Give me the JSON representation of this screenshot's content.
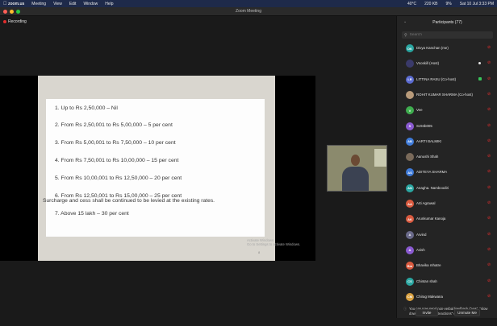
{
  "menubar": {
    "items": [
      "zoom.us",
      "Meeting",
      "View",
      "Edit",
      "Window",
      "Help"
    ],
    "status": [
      "40°C",
      "220 KB",
      "9%",
      "Sat 10 Jul 3:33 PM"
    ]
  },
  "window": {
    "title": "Zoom Meeting"
  },
  "recording": {
    "label": "Recording"
  },
  "slide": {
    "slabs": [
      "1. Up to Rs 2,50,000 – Nil",
      "2. From Rs 2,50,001 to Rs 5,00,000 – 5 per cent",
      "3. From Rs 5,00,001 to Rs 7,50,000 – 10 per cent",
      "4. From Rs 7,50,001 to Rs 10,00,000 – 15 per cent",
      "5. From Rs 10,00,001 to Rs 12,50,000 – 20 per cent",
      "6. From Rs 12,50,001 to Rs 15,00,000 – 25 per cent",
      "7. Above 15 lakh – 30 per cent"
    ],
    "note": "Surcharge and cess shall be continued to be levied at the existing rates.",
    "watermark_1": "Activate Windows",
    "watermark_2": "Go to Settings to activate Windows.",
    "page": "8"
  },
  "panel": {
    "title": "Participants (77)",
    "search_placeholder": "Search",
    "participants": [
      {
        "initials": "DK",
        "name": "Divya Kanchan (me)",
        "color": "#2aa6a1"
      },
      {
        "initials": "",
        "name": "Vsoskill (Host)",
        "color": "#3a3a6a"
      },
      {
        "initials": "LR",
        "name": "LITTINA RASU (Co-host)",
        "color": "#5b6bd1"
      },
      {
        "initials": "",
        "name": "ROHIT KUMAR SHARMA (Co-host)",
        "color": "#b89a7a"
      },
      {
        "initials": "V",
        "name": "Vee",
        "color": "#3fae4f"
      },
      {
        "initials": "S",
        "name": "Sc94b005",
        "color": "#8a5ad1"
      },
      {
        "initials": "AB",
        "name": "AARTI BALMIKI",
        "color": "#3f7bd9"
      },
      {
        "initials": "",
        "name": "Aanushi Shah",
        "color": "#7a6a5a"
      },
      {
        "initials": "AS",
        "name": "ADITEYA SHARMA",
        "color": "#3f7bd9"
      },
      {
        "initials": "AN",
        "name": "Anagha. Namboodiri",
        "color": "#2aa6a1"
      },
      {
        "initials": "AA",
        "name": "Arti Agrawal",
        "color": "#d95a3f"
      },
      {
        "initials": "AK",
        "name": "Arunkumar Kanoja",
        "color": "#d95a3f"
      },
      {
        "initials": "A",
        "name": "Arvind",
        "color": "#6a6a8a"
      },
      {
        "initials": "A",
        "name": "Avish",
        "color": "#8a5ad1"
      },
      {
        "initials": "Bm",
        "name": "Bhavika mhatre",
        "color": "#d95a3f"
      },
      {
        "initials": "CS",
        "name": "Chintan shah",
        "color": "#2aa6a1"
      },
      {
        "initials": "CM",
        "name": "Chirag Makwana",
        "color": "#d9a03f"
      }
    ],
    "tip": "You can now send non-verbal feedback (\"yes\", \"slow down\", etc.) from \"Reactions\" on the toolbar.",
    "invite_label": "Invite",
    "unmute_label": "Unmute Me"
  }
}
